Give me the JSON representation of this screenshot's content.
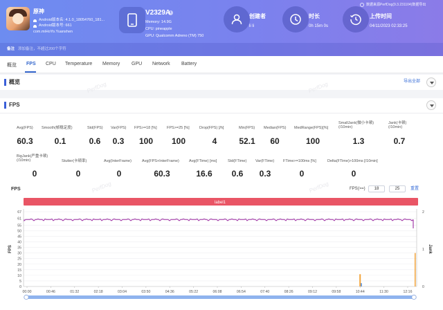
{
  "header": {
    "app_name": "原神",
    "android_ver": "Android版本名: 4.1.0_18054760_181...",
    "android_code": "Android版本号: 661",
    "package": "com.miHoYo.Yuanshen",
    "device": "V2329A",
    "memory": "Memory: 14.9G",
    "cpu": "CPU: pineapple",
    "gpu": "GPU: Qualcomm Adreno (TM) 750",
    "creator_label": "创建者",
    "creator_value": "li li",
    "duration_label": "时长",
    "duration_value": "0h 15m 0s",
    "upload_label": "上传时间",
    "upload_value": "04/11/2023 02:33:25",
    "data_source": "数据来源PerfDog(9.3.231104)数据导出",
    "note_label": "备注",
    "note_placeholder": "添加备注，不超过200个字符"
  },
  "tabs": [
    "概览",
    "FPS",
    "CPU",
    "Temperature",
    "Memory",
    "GPU",
    "Network",
    "Battery"
  ],
  "overview": {
    "title": "概览",
    "export_all": "导出全部"
  },
  "fps_panel": {
    "title": "FPS"
  },
  "stats_row1": [
    {
      "label": "Avg(FPS)",
      "value": "60.3"
    },
    {
      "label": "Smooth(帧稳定度)",
      "value": "0.1"
    },
    {
      "label": "Std(FPS)",
      "value": "0.6"
    },
    {
      "label": "Var(FPS)",
      "value": "0.3"
    },
    {
      "label": "FPS>=18 [%]",
      "value": "100"
    },
    {
      "label": "FPS>=25 [%]",
      "value": "100"
    },
    {
      "label": "Drop(FPS) [/h]",
      "value": "4"
    },
    {
      "label": "Min(FPS)",
      "value": "52.1"
    },
    {
      "label": "Median(FPS)",
      "value": "60"
    },
    {
      "label": "MedRange(FPS)[%]",
      "value": "100"
    },
    {
      "label": "SmallJank(微小卡顿)\n(/10min)",
      "value": "1.3"
    },
    {
      "label": "Jank(卡顿)\n(/10min)",
      "value": "0.7"
    }
  ],
  "stats_row2": [
    {
      "label": "BigJank(严重卡顿)\n(/10min)",
      "value": "0"
    },
    {
      "label": "Stutter(卡顿率)",
      "value": "0"
    },
    {
      "label": "Avg(InterFrame)",
      "value": "0"
    },
    {
      "label": "Avg(FPS+InterFrame)",
      "value": "60.3"
    },
    {
      "label": "Avg(FTime) [ms]",
      "value": "16.6"
    },
    {
      "label": "Std(FTime)",
      "value": "0.6"
    },
    {
      "label": "Var(FTime)",
      "value": "0.3"
    },
    {
      "label": "FTime>=100ms [%]",
      "value": "0"
    },
    {
      "label": "Delta(FTime)>100ms [/10min]",
      "value": "0"
    }
  ],
  "chart_controls": {
    "title": "FPS",
    "threshold_label": "FPS(>=)",
    "threshold_1": "18",
    "threshold_2": "25",
    "reset": "重置"
  },
  "watermark": "PerfDog",
  "colors": {
    "fps_line": "#a23ca8",
    "jank": "#f2a33a",
    "bigjank": "#4a86d8",
    "label_bar": "#e95565"
  },
  "chart_data": {
    "type": "line",
    "label_bar": "label1",
    "y_left": {
      "label": "FPS",
      "ticks": [
        0,
        5,
        10,
        15,
        20,
        25,
        30,
        35,
        40,
        45,
        50,
        55,
        61,
        67
      ],
      "ylim": [
        0,
        67
      ]
    },
    "y_right": {
      "label": "Jank",
      "ticks": [
        0,
        1,
        2
      ],
      "ylim": [
        0,
        2
      ]
    },
    "x_ticks": [
      "00:00",
      "00:46",
      "01:32",
      "02:18",
      "03:04",
      "03:50",
      "04:36",
      "05:22",
      "06:08",
      "06:54",
      "07:40",
      "08:26",
      "09:12",
      "09:58",
      "10:44",
      "11:30",
      "12:16"
    ],
    "series": [
      {
        "name": "FPS",
        "approx_value": 60,
        "min": 52.1
      },
      {
        "name": "Jank",
        "events": [
          "10:44"
        ]
      }
    ]
  }
}
